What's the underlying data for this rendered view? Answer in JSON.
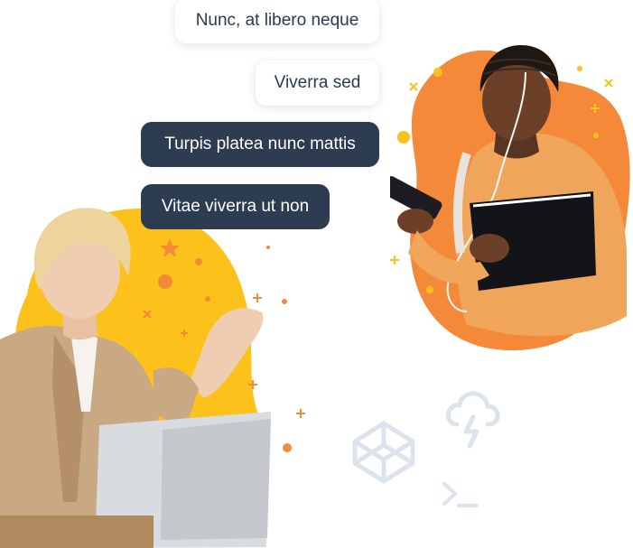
{
  "messages": [
    {
      "text": "Nunc, at libero neque",
      "style": "light"
    },
    {
      "text": "Viverra sed",
      "style": "light"
    },
    {
      "text": "Turpis platea nunc mattis",
      "style": "dark"
    },
    {
      "text": "Vitae viverra ut non",
      "style": "dark"
    }
  ],
  "colors": {
    "orange_blob": "#f5893a",
    "yellow_blob": "#fcc21b",
    "dark_bubble": "#2e3c52",
    "light_bubble": "#ffffff",
    "text_dark": "#2b3a4e",
    "icon_grey": "#d9e0ea"
  },
  "icons": [
    "codepen-icon",
    "cloud-lightning-icon",
    "terminal-icon",
    "sparkle-decoration",
    "star-decoration"
  ]
}
